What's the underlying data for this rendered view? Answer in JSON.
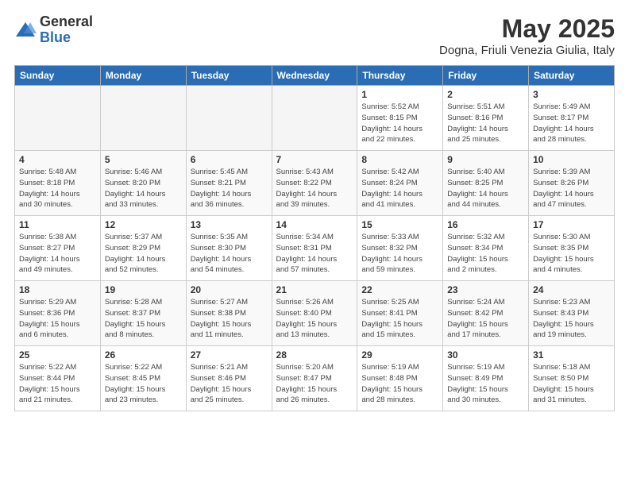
{
  "header": {
    "logo_general": "General",
    "logo_blue": "Blue",
    "month_title": "May 2025",
    "location": "Dogna, Friuli Venezia Giulia, Italy"
  },
  "weekdays": [
    "Sunday",
    "Monday",
    "Tuesday",
    "Wednesday",
    "Thursday",
    "Friday",
    "Saturday"
  ],
  "weeks": [
    [
      {
        "day": "",
        "info": ""
      },
      {
        "day": "",
        "info": ""
      },
      {
        "day": "",
        "info": ""
      },
      {
        "day": "",
        "info": ""
      },
      {
        "day": "1",
        "info": "Sunrise: 5:52 AM\nSunset: 8:15 PM\nDaylight: 14 hours\nand 22 minutes."
      },
      {
        "day": "2",
        "info": "Sunrise: 5:51 AM\nSunset: 8:16 PM\nDaylight: 14 hours\nand 25 minutes."
      },
      {
        "day": "3",
        "info": "Sunrise: 5:49 AM\nSunset: 8:17 PM\nDaylight: 14 hours\nand 28 minutes."
      }
    ],
    [
      {
        "day": "4",
        "info": "Sunrise: 5:48 AM\nSunset: 8:18 PM\nDaylight: 14 hours\nand 30 minutes."
      },
      {
        "day": "5",
        "info": "Sunrise: 5:46 AM\nSunset: 8:20 PM\nDaylight: 14 hours\nand 33 minutes."
      },
      {
        "day": "6",
        "info": "Sunrise: 5:45 AM\nSunset: 8:21 PM\nDaylight: 14 hours\nand 36 minutes."
      },
      {
        "day": "7",
        "info": "Sunrise: 5:43 AM\nSunset: 8:22 PM\nDaylight: 14 hours\nand 39 minutes."
      },
      {
        "day": "8",
        "info": "Sunrise: 5:42 AM\nSunset: 8:24 PM\nDaylight: 14 hours\nand 41 minutes."
      },
      {
        "day": "9",
        "info": "Sunrise: 5:40 AM\nSunset: 8:25 PM\nDaylight: 14 hours\nand 44 minutes."
      },
      {
        "day": "10",
        "info": "Sunrise: 5:39 AM\nSunset: 8:26 PM\nDaylight: 14 hours\nand 47 minutes."
      }
    ],
    [
      {
        "day": "11",
        "info": "Sunrise: 5:38 AM\nSunset: 8:27 PM\nDaylight: 14 hours\nand 49 minutes."
      },
      {
        "day": "12",
        "info": "Sunrise: 5:37 AM\nSunset: 8:29 PM\nDaylight: 14 hours\nand 52 minutes."
      },
      {
        "day": "13",
        "info": "Sunrise: 5:35 AM\nSunset: 8:30 PM\nDaylight: 14 hours\nand 54 minutes."
      },
      {
        "day": "14",
        "info": "Sunrise: 5:34 AM\nSunset: 8:31 PM\nDaylight: 14 hours\nand 57 minutes."
      },
      {
        "day": "15",
        "info": "Sunrise: 5:33 AM\nSunset: 8:32 PM\nDaylight: 14 hours\nand 59 minutes."
      },
      {
        "day": "16",
        "info": "Sunrise: 5:32 AM\nSunset: 8:34 PM\nDaylight: 15 hours\nand 2 minutes."
      },
      {
        "day": "17",
        "info": "Sunrise: 5:30 AM\nSunset: 8:35 PM\nDaylight: 15 hours\nand 4 minutes."
      }
    ],
    [
      {
        "day": "18",
        "info": "Sunrise: 5:29 AM\nSunset: 8:36 PM\nDaylight: 15 hours\nand 6 minutes."
      },
      {
        "day": "19",
        "info": "Sunrise: 5:28 AM\nSunset: 8:37 PM\nDaylight: 15 hours\nand 8 minutes."
      },
      {
        "day": "20",
        "info": "Sunrise: 5:27 AM\nSunset: 8:38 PM\nDaylight: 15 hours\nand 11 minutes."
      },
      {
        "day": "21",
        "info": "Sunrise: 5:26 AM\nSunset: 8:40 PM\nDaylight: 15 hours\nand 13 minutes."
      },
      {
        "day": "22",
        "info": "Sunrise: 5:25 AM\nSunset: 8:41 PM\nDaylight: 15 hours\nand 15 minutes."
      },
      {
        "day": "23",
        "info": "Sunrise: 5:24 AM\nSunset: 8:42 PM\nDaylight: 15 hours\nand 17 minutes."
      },
      {
        "day": "24",
        "info": "Sunrise: 5:23 AM\nSunset: 8:43 PM\nDaylight: 15 hours\nand 19 minutes."
      }
    ],
    [
      {
        "day": "25",
        "info": "Sunrise: 5:22 AM\nSunset: 8:44 PM\nDaylight: 15 hours\nand 21 minutes."
      },
      {
        "day": "26",
        "info": "Sunrise: 5:22 AM\nSunset: 8:45 PM\nDaylight: 15 hours\nand 23 minutes."
      },
      {
        "day": "27",
        "info": "Sunrise: 5:21 AM\nSunset: 8:46 PM\nDaylight: 15 hours\nand 25 minutes."
      },
      {
        "day": "28",
        "info": "Sunrise: 5:20 AM\nSunset: 8:47 PM\nDaylight: 15 hours\nand 26 minutes."
      },
      {
        "day": "29",
        "info": "Sunrise: 5:19 AM\nSunset: 8:48 PM\nDaylight: 15 hours\nand 28 minutes."
      },
      {
        "day": "30",
        "info": "Sunrise: 5:19 AM\nSunset: 8:49 PM\nDaylight: 15 hours\nand 30 minutes."
      },
      {
        "day": "31",
        "info": "Sunrise: 5:18 AM\nSunset: 8:50 PM\nDaylight: 15 hours\nand 31 minutes."
      }
    ]
  ]
}
